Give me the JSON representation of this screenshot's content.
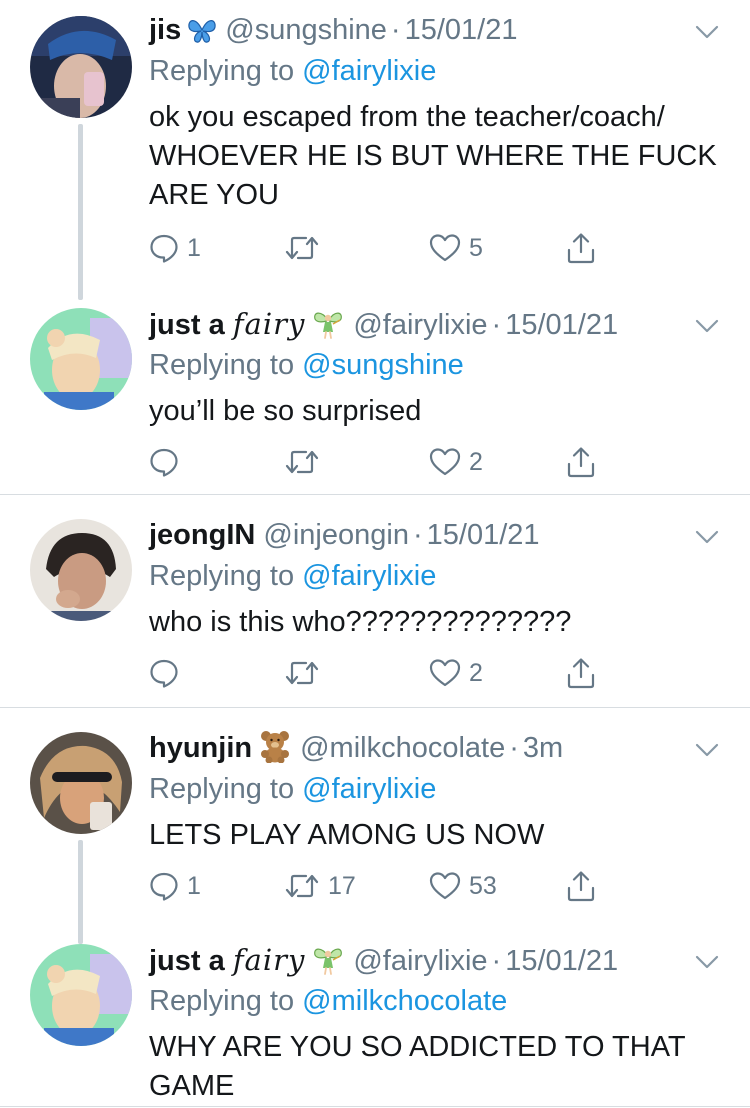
{
  "reply_prefix": "Replying to",
  "tweets": [
    {
      "name": "jis",
      "name_emoji": "butterfly",
      "handle": "@sungshine",
      "time": "15/01/21",
      "reply_to": "@fairylixie",
      "text": "ok you escaped from the teacher/coach/\nWHOEVER HE IS BUT WHERE THE FUCK\nARE YOU",
      "replies": "1",
      "retweets": "",
      "likes": "5",
      "avatar_colors": [
        "#1f2a44",
        "#d9b9a8"
      ]
    },
    {
      "name": "just a ",
      "name_stylized": "fairy",
      "name_emoji": "fairy",
      "handle": "@fairylixie",
      "time": "15/01/21",
      "reply_to": "@sungshine",
      "text": "you’ll be so surprised",
      "replies": "",
      "retweets": "",
      "likes": "2",
      "avatar_colors": [
        "#8ee0b8",
        "#f1d4b0"
      ]
    },
    {
      "name": "jeongIN",
      "handle": "@injeongin",
      "time": "15/01/21",
      "reply_to": "@fairylixie",
      "text": "who is this who??????????????",
      "replies": "",
      "retweets": "",
      "likes": "2",
      "avatar_colors": [
        "#e8e4de",
        "#c99b82"
      ]
    },
    {
      "name": "hyunjin",
      "name_emoji": "teddy-bear",
      "handle": "@milkchocolate",
      "time": "3m",
      "reply_to": "@fairylixie",
      "text": "LETS PLAY AMONG US NOW",
      "replies": "1",
      "retweets": "17",
      "likes": "53",
      "avatar_colors": [
        "#5a5148",
        "#d8a27a"
      ]
    },
    {
      "name": "just a ",
      "name_stylized": "fairy",
      "name_emoji": "fairy",
      "handle": "@fairylixie",
      "time": "15/01/21",
      "reply_to": "@milkchocolate",
      "text": "WHY ARE YOU SO ADDICTED TO THAT\nGAME",
      "avatar_colors": [
        "#8ee0b8",
        "#f1d4b0"
      ]
    }
  ],
  "colors": {
    "text": "#14171a",
    "secondary": "#657786",
    "link": "#1b95e0",
    "divider": "#d8dde1"
  }
}
